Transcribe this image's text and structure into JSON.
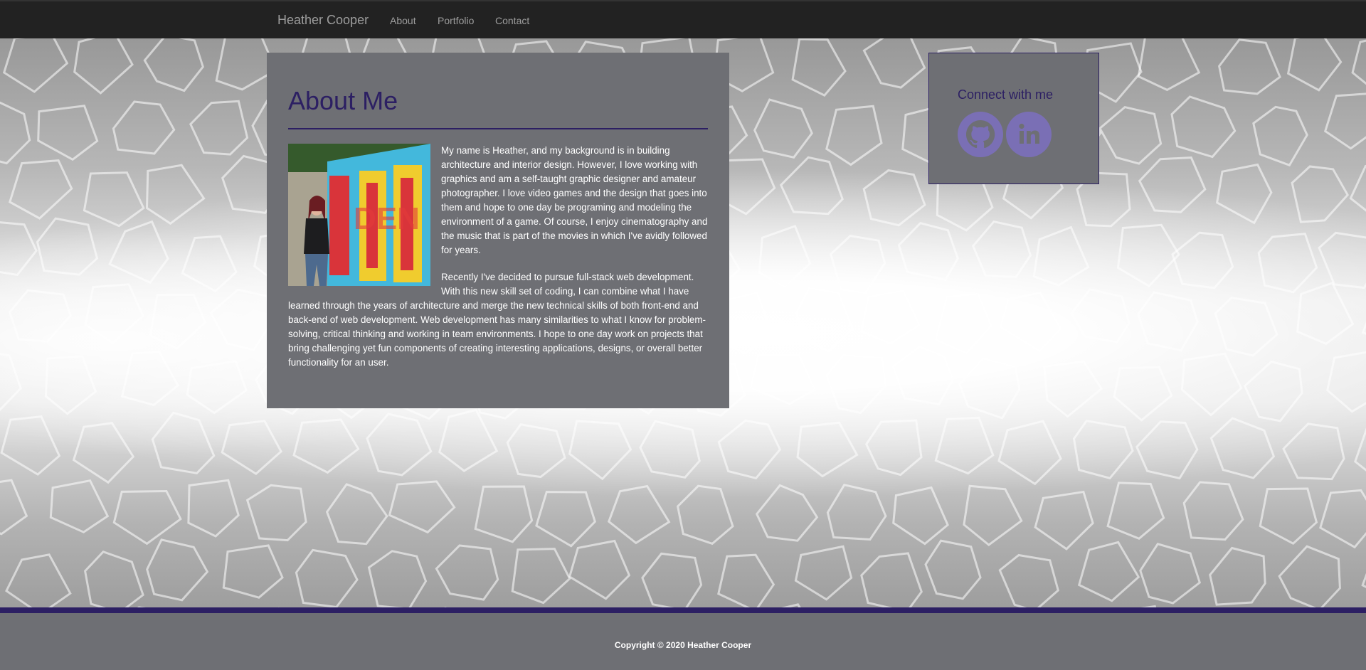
{
  "nav": {
    "brand": "Heather Cooper",
    "links": [
      "About",
      "Portfolio",
      "Contact"
    ]
  },
  "about": {
    "title": "About Me",
    "paragraphs": [
      "My name is Heather, and my background is in building architecture and interior design. However, I love working with graphics and am a self-taught graphic designer and amateur photographer. I love video games and the design that goes into them and hope to one day be programing and modeling the environment of a game. Of course, I enjoy cinematography and the music that is part of the movies in which I've avidly followed for years.",
      "Recently I've decided to pursue full-stack web development. With this new skill set of coding, I can combine what I have learned through the years of architecture and merge the new technical skills of both front-end and back-end of web development. Web development has many similarities to what I know for problem-solving, critical thinking and working in team environments. I hope to one day work on projects that bring challenging yet fun components of creating interesting applications, designs, or overall better functionality for an user."
    ],
    "photo_mural_text": "DEN"
  },
  "connect": {
    "title": "Connect with me",
    "icons": [
      "github-icon",
      "linkedin-icon"
    ]
  },
  "footer": {
    "copyright": "Copyright © 2020 Heather Cooper"
  },
  "colors": {
    "accent": "#2c1f63",
    "panel": "#6e6f74",
    "navbar": "#222222",
    "nav_text": "#9d9d9d",
    "icon": "#7a6fb5"
  }
}
